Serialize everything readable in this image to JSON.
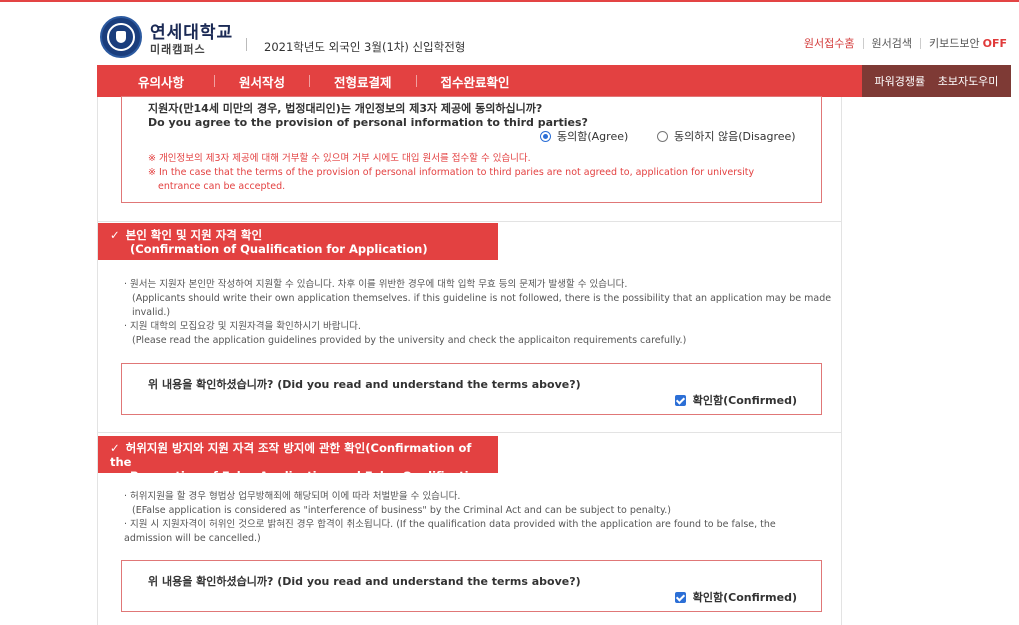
{
  "header": {
    "university_name": "연세대학교",
    "campus_name": "미래캠퍼스",
    "page_title": "2021학년도 외국인 3월(1차) 신입학전형",
    "util_links": {
      "apply_home": "원서접수홈",
      "apply_search": "원서검색",
      "keyboard_security": "키보드보안",
      "keyboard_security_state": "OFF"
    }
  },
  "nav": {
    "items": [
      {
        "label": "유의사항"
      },
      {
        "label": "원서작성"
      },
      {
        "label": "전형료결제"
      },
      {
        "label": "접수완료확인"
      }
    ],
    "active_index": 1
  },
  "sidenav": {
    "items": [
      {
        "label": "파워경쟁률"
      },
      {
        "label": "초보자도우미"
      }
    ]
  },
  "third_party": {
    "question_kr": "지원자(만14세 미만의 경우, 법정대리인)는 개인정보의 제3자 제공에 동의하십니까?",
    "question_en": "Do you agree to the provision of personal information to third parties?",
    "agree_label": "동의함(Agree)",
    "disagree_label": "동의하지 않음(Disagree)",
    "selected": "agree",
    "note_kr": "※ 개인정보의 제3자 제공에 대해 거부할 수 있으며 거부 시에도 대입 원서를 접수할 수 있습니다.",
    "note_en_1": "※ In the case that the terms of the provision of personal information to third paries are not agreed to, application for university",
    "note_en_2": "entrance can be accepted."
  },
  "identity_section": {
    "heading_kr": "본인 확인 및 지원 자격 확인",
    "heading_en": "(Confirmation of Qualification for Application)",
    "bullet1_kr": "· 원서는 지원자 본인만 작성하여 지원할 수 있습니다. 차후 이를 위반한 경우에 대학 입학 무효 등의 문제가 발생할 수 있습니다.",
    "bullet1_en_1": "(Applicants should write their own application themselves. if this guideline is not followed, there is the possibility that an application may be made",
    "bullet1_en_2": "invalid.)",
    "bullet2_kr": "· 지원 대학의 모집요강 및 지원자격을 확인하시기 바랍니다.",
    "bullet2_en": "(Please read the application guidelines provided by the university and check the applicaiton requirements carefully.)",
    "confirm_question": "위 내용을 확인하셨습니까? (Did you read and understand the terms above?)",
    "confirm_label": "확인함(Confirmed)",
    "confirmed": true
  },
  "false_app_section": {
    "heading_line1": "허위지원 방지와 지원 자격 조작 방지에 관한 확인(Confirmation of the",
    "heading_line2": "Prevention of False Application and False Qualification for Application)",
    "bullet1_kr": "· 허위지원을 할 경우 형법상 업무방해죄에 해당되며 이에 따라 처벌받을 수 있습니다.",
    "bullet1_en": "(EFalse application is considered as \"interference of business\" by the Criminal Act and can be subject to penalty.)",
    "bullet2_line1": "· 지원 시 지원자격이 허위인 것으로 밝혀진 경우 합격이 취소됩니다. (If the qualification data provided with the application are found to be false, the",
    "bullet2_line2": "admission will be cancelled.)",
    "confirm_question": "위 내용을 확인하셨습니까? (Did you read and understand the terms above?)",
    "confirm_label": "확인함(Confirmed)",
    "confirmed": true
  },
  "colors": {
    "accent_red": "#e34141",
    "side_nav_brown": "#7e3a35",
    "check_blue": "#2c6fd6"
  }
}
